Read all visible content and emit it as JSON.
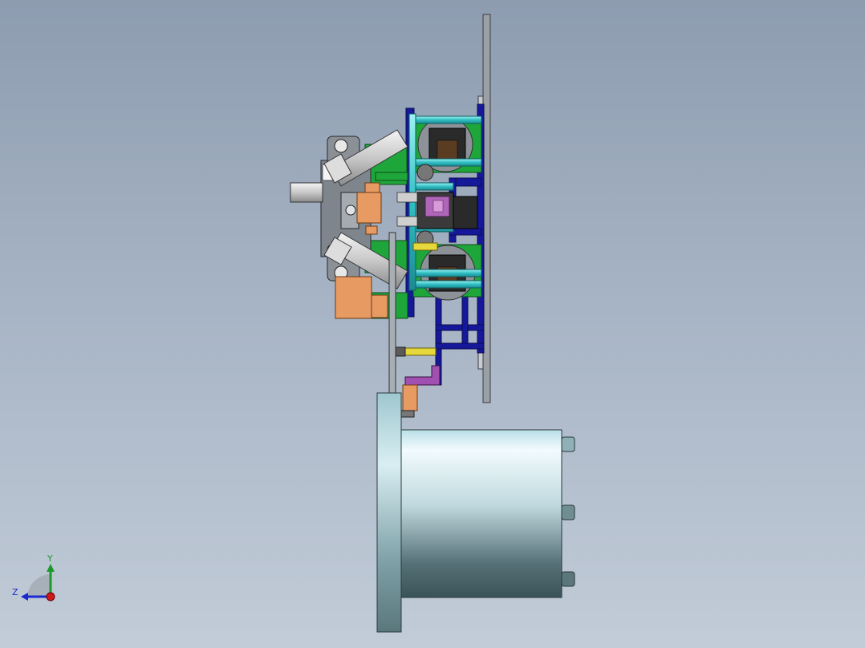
{
  "triad": {
    "y_label": "Y",
    "z_label": "Z",
    "x_color": "#d01818",
    "y_color": "#1a9a2a",
    "z_color": "#1a2ad0"
  },
  "colors": {
    "background_top": "#8d9cb0",
    "background_bottom": "#c2ccd8",
    "green_plate": "#1fa63a",
    "cyan_rod": "#3cc6c8",
    "navy_frame": "#16189a",
    "orange_block": "#e79a62",
    "purple_part": "#b066b8",
    "yellow_pin": "#e6d83a",
    "gray_housing": "#7f858c",
    "silver_motor": "#c9e6ee"
  }
}
